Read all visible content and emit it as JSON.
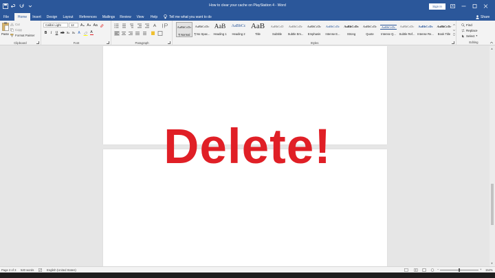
{
  "window": {
    "title": "How to clear your cache on PlayStation 4  -  Word",
    "sign_in": "Sign in"
  },
  "tabs": [
    "File",
    "Home",
    "Insert",
    "Design",
    "Layout",
    "References",
    "Mailings",
    "Review",
    "View",
    "Help"
  ],
  "active_tab": "Home",
  "tell_me": "Tell me what you want to do",
  "share": "Share",
  "clipboard": {
    "paste": "Paste",
    "cut": "Cut",
    "copy": "Copy",
    "format_painter": "Format Painter",
    "label": "Clipboard"
  },
  "font": {
    "name": "Calibri Light",
    "size": "12",
    "label": "Font",
    "bold": "B",
    "italic": "I",
    "underline": "U"
  },
  "paragraph": {
    "label": "Paragraph"
  },
  "styles": {
    "label": "Styles",
    "items": [
      {
        "sample": "AaBbCcDc",
        "name": "¶ Normal"
      },
      {
        "sample": "AaBbCcDc",
        "name": "¶ No Spac..."
      },
      {
        "sample": "AaB",
        "name": "Heading 1"
      },
      {
        "sample": "AaBbCc",
        "name": "Heading 2"
      },
      {
        "sample": "AaB",
        "name": "Title"
      },
      {
        "sample": "AaBbCcD",
        "name": "Subtitle"
      },
      {
        "sample": "AaBbCcDc",
        "name": "Subtle Em..."
      },
      {
        "sample": "AaBbCcDc",
        "name": "Emphasis"
      },
      {
        "sample": "AaBbCcDc",
        "name": "Intense E..."
      },
      {
        "sample": "AaBbCcDc",
        "name": "Strong"
      },
      {
        "sample": "AaBbCcDc",
        "name": "Quote"
      },
      {
        "sample": "AaBbCcDc",
        "name": "Intense Q..."
      },
      {
        "sample": "AaBbCcDc",
        "name": "Subtle Ref..."
      },
      {
        "sample": "AaBbCcDc",
        "name": "Intense Re..."
      },
      {
        "sample": "AaBbCcDc",
        "name": "Book Title"
      }
    ]
  },
  "editing": {
    "find": "Find",
    "replace": "Replace",
    "select": "Select",
    "label": "Editing"
  },
  "document": {
    "overlay_text": "Delete!"
  },
  "status": {
    "page": "Page 2 of 3",
    "words": "520 words",
    "language": "English (United States)",
    "zoom": "154%"
  },
  "colors": {
    "title_bar": "#2b579a",
    "overlay_text": "#e01f26"
  }
}
